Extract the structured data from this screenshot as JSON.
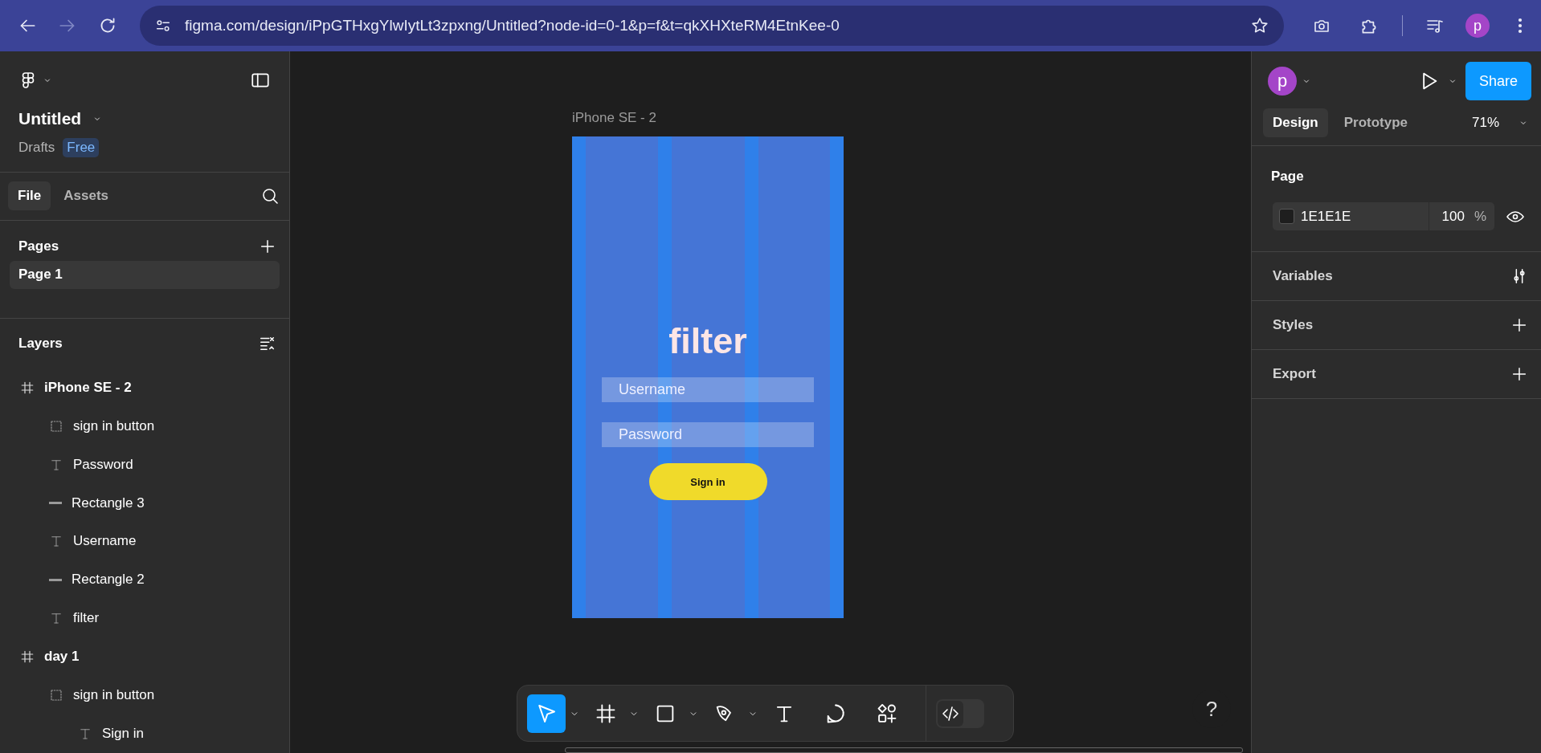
{
  "browser": {
    "nav": [
      {
        "kind": "back",
        "disabled": false
      },
      {
        "kind": "forward",
        "disabled": true
      },
      {
        "kind": "reload",
        "disabled": false
      }
    ],
    "url": "figma.com/design/iPpGTHxgYlwIytLt3zpxng/Untitled?node-id=0-1&p=f&t=qkXHXteRM4EtnKee-0",
    "profile": "p"
  },
  "file": {
    "title": "Untitled",
    "location": "Drafts",
    "plan": "Free"
  },
  "panel_tabs": [
    {
      "label": "File",
      "selected": true
    },
    {
      "label": "Assets",
      "selected": false
    }
  ],
  "pages": {
    "heading": "Pages",
    "items": [
      {
        "label": "Page 1",
        "selected": true
      }
    ]
  },
  "layers": {
    "heading": "Layers",
    "items": [
      {
        "label": "iPhone SE - 2",
        "kind": "frame",
        "children": [
          {
            "label": "sign in button",
            "kind": "group"
          },
          {
            "label": "Password",
            "kind": "text"
          },
          {
            "label": "Rectangle 3",
            "kind": "line"
          },
          {
            "label": "Username",
            "kind": "text"
          },
          {
            "label": "Rectangle 2",
            "kind": "line"
          },
          {
            "label": "filter",
            "kind": "text"
          }
        ]
      },
      {
        "label": "day 1",
        "kind": "frame",
        "children": [
          {
            "label": "sign in button",
            "kind": "group",
            "children": [
              {
                "label": "Sign in",
                "kind": "text"
              }
            ]
          }
        ]
      }
    ]
  },
  "canvas": {
    "frame_label": "iPhone SE - 2",
    "frame": {
      "title": "filter",
      "fields": [
        {
          "placeholder": "Username"
        },
        {
          "placeholder": "Password"
        }
      ],
      "button": "Sign in"
    }
  },
  "toolbar": {
    "tools": [
      {
        "kind": "move",
        "selected": true,
        "has_menu": true
      },
      {
        "kind": "frame",
        "selected": false,
        "has_menu": true
      },
      {
        "kind": "rectangle",
        "selected": false,
        "has_menu": true
      },
      {
        "kind": "pen",
        "selected": false,
        "has_menu": true
      },
      {
        "kind": "text",
        "selected": false,
        "has_menu": false
      },
      {
        "kind": "comment",
        "selected": false,
        "has_menu": false
      },
      {
        "kind": "actions",
        "selected": false,
        "has_menu": false
      }
    ],
    "dev_mode": {
      "on": false
    }
  },
  "right_panel": {
    "avatar": "p",
    "share": "Share",
    "tabs": [
      {
        "label": "Design",
        "selected": true
      },
      {
        "label": "Prototype",
        "selected": false
      }
    ],
    "zoom": "71%",
    "page": {
      "heading": "Page",
      "color": "1E1E1E",
      "opacity": "100",
      "unit": "%"
    },
    "sections": [
      {
        "label": "Variables",
        "kind": "variables"
      },
      {
        "label": "Styles",
        "kind": "add"
      },
      {
        "label": "Export",
        "kind": "add"
      }
    ]
  },
  "help": "?"
}
